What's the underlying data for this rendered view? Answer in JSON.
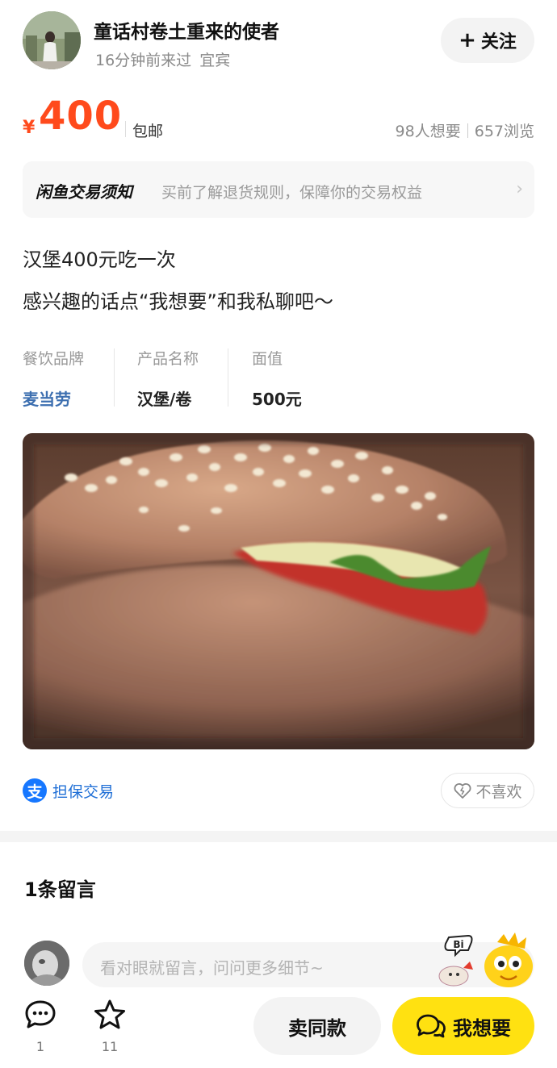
{
  "seller": {
    "name": "童话村卷土重来的使者",
    "last_seen": "16分钟前来过",
    "location": "宜宾",
    "follow_label": "关注"
  },
  "price": {
    "currency": "¥",
    "amount": "400",
    "shipping": "包邮",
    "wants": "98人想要",
    "views": "657浏览",
    "accent_color": "#ff4a1c"
  },
  "notice": {
    "title": "闲鱼交易须知",
    "text": "买前了解退货规则，保障你的交易权益"
  },
  "description": {
    "line1": "汉堡400元吃一次",
    "line2": "感兴趣的话点“我想要”和我私聊吧～"
  },
  "attributes": [
    {
      "key": "餐饮品牌",
      "value": "麦当劳"
    },
    {
      "key": "产品名称",
      "value": "汉堡/卷"
    },
    {
      "key": "面值",
      "value": "500元"
    }
  ],
  "guarantee": {
    "icon_char": "支",
    "label": "担保交易",
    "dislike_label": "不喜欢"
  },
  "comments": {
    "title": "1条留言",
    "placeholder": "看对眼就留言，问问更多细节~",
    "mascot_badge": "Bi"
  },
  "bottom_bar": {
    "comment_count": "1",
    "favorite_count": "11",
    "sell_same_label": "卖同款",
    "want_label": "我想要",
    "want_color": "#ffe111"
  }
}
